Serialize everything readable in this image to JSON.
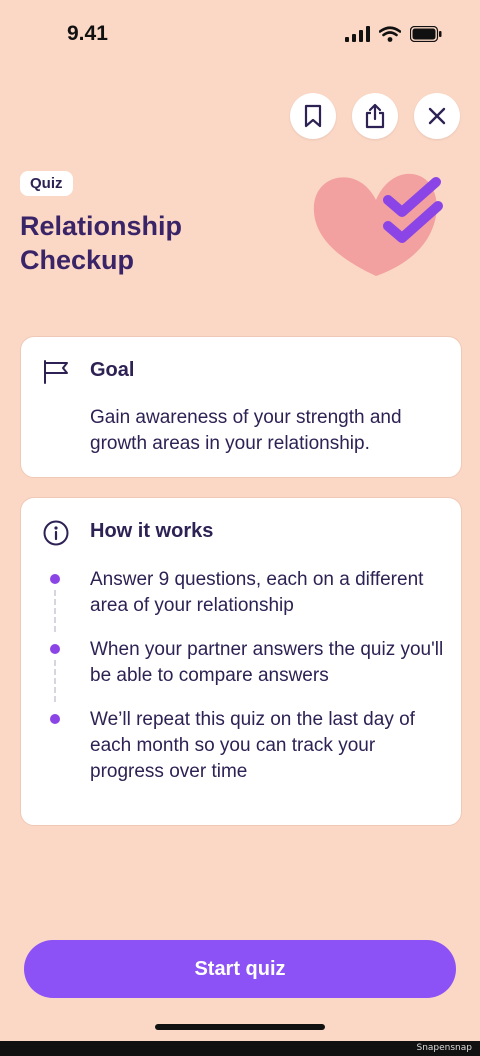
{
  "status_bar": {
    "time": "9.41"
  },
  "header": {
    "bookmark_icon": "bookmark-icon",
    "share_icon": "share-icon",
    "close_icon": "close-icon"
  },
  "hero": {
    "badge": "Quiz",
    "title": "Relationship Checkup",
    "illustration": "heart-with-checkmarks",
    "colors": {
      "heart": "#f2a0a0",
      "checkmarks": "#8b45e6"
    }
  },
  "goal_card": {
    "icon": "flag-icon",
    "title": "Goal",
    "body": "Gain awareness of your strength and growth areas in your relationship."
  },
  "how_card": {
    "icon": "info-icon",
    "title": "How it works",
    "steps": [
      "Answer 9 questions, each on a different area of your relationship",
      "When your partner answers the quiz you'll be able to compare answers",
      "We’ll repeat this quiz on the last day of each month so you can track your progress over time"
    ]
  },
  "cta": {
    "label": "Start quiz"
  },
  "watermark": "Snapensnap",
  "colors": {
    "background": "#fbd7c5",
    "accent": "#8c52f5",
    "title": "#3a2468"
  }
}
